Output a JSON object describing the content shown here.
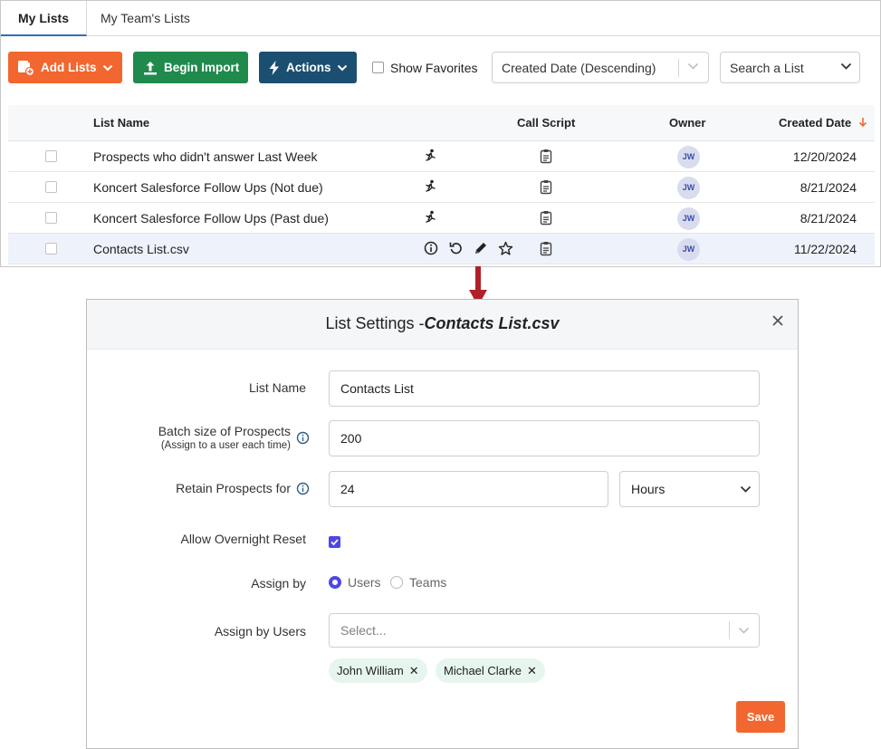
{
  "tabs": [
    {
      "label": "My Lists"
    },
    {
      "label": "My Team's Lists"
    }
  ],
  "toolbar": {
    "add_lists": "Add Lists",
    "begin_import": "Begin Import",
    "actions": "Actions",
    "show_favorites": "Show Favorites",
    "sort_value": "Created Date (Descending)",
    "search_placeholder": "Search a List"
  },
  "table": {
    "headers": {
      "list_name": "List Name",
      "call_script": "Call Script",
      "owner": "Owner",
      "created_date": "Created Date"
    },
    "rows": [
      {
        "name": "Prospects who didn't answer Last Week",
        "owner": "JW",
        "date": "12/20/2024"
      },
      {
        "name": "Koncert Salesforce Follow Ups (Not due)",
        "owner": "JW",
        "date": "8/21/2024"
      },
      {
        "name": "Koncert Salesforce Follow Ups (Past due)",
        "owner": "JW",
        "date": "8/21/2024"
      },
      {
        "name": "Contacts List.csv",
        "owner": "JW",
        "date": "11/22/2024"
      }
    ]
  },
  "colors": {
    "orange": "#f2672f",
    "green": "#1f8a4c",
    "navy": "#1b4f72",
    "accent": "#4f46e5",
    "arrow": "#b0202a"
  },
  "modal": {
    "title_prefix": "List Settings -",
    "title_file": "Contacts List.csv",
    "list_name_label": "List Name",
    "list_name_value": "Contacts List",
    "batch_label": "Batch size of Prospects",
    "batch_sub": "(Assign to a user each time)",
    "batch_value": "200",
    "retain_label": "Retain Prospects for",
    "retain_value": "24",
    "retain_unit": "Hours",
    "overnight_label": "Allow Overnight Reset",
    "assign_by_label": "Assign by",
    "assign_users": "Users",
    "assign_teams": "Teams",
    "assign_users_label": "Assign by Users",
    "select_placeholder": "Select...",
    "chips": [
      "John William",
      "Michael Clarke"
    ],
    "save": "Save"
  }
}
